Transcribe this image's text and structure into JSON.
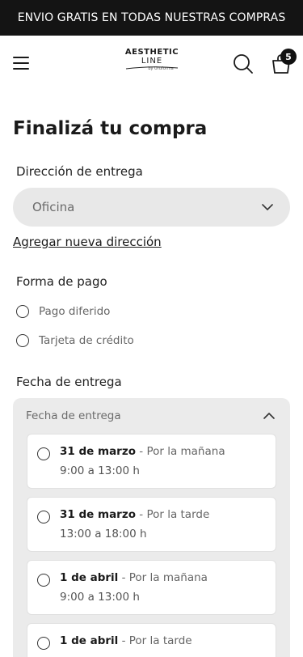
{
  "promo": {
    "text": "ENVIO GRATIS EN TODAS NUESTRAS COMPRAS"
  },
  "header": {
    "logo_line1": "AESTHETIC",
    "logo_line2": "LINE",
    "logo_sub": "by Uruforma",
    "cart_count": "5"
  },
  "page": {
    "title": "Finalizá tu compra"
  },
  "address": {
    "label": "Dirección de entrega",
    "selected": "Oficina",
    "add_link": "Agregar nueva dirección"
  },
  "payment": {
    "label": "Forma de pago",
    "options": [
      "Pago diferido",
      "Tarjeta de crédito"
    ]
  },
  "delivery": {
    "label": "Fecha de entrega",
    "accordion_title": "Fecha de entrega",
    "slots": [
      {
        "date": "31 de marzo",
        "period": " - Por la mañana",
        "hours": "9:00 a 13:00 h"
      },
      {
        "date": "31 de marzo",
        "period": " - Por la tarde",
        "hours": "13:00 a 18:00 h"
      },
      {
        "date": "1 de abril",
        "period": " - Por la mañana",
        "hours": "9:00 a 13:00 h"
      },
      {
        "date": "1 de abril",
        "period": " - Por la tarde",
        "hours": ""
      }
    ]
  },
  "colors": {
    "promo_bg": "#141414",
    "select_bg": "#e8e8e8",
    "accordion_bg": "#ebebeb"
  },
  "icons": [
    "menu-icon",
    "search-icon",
    "cart-icon",
    "chevron-down-icon",
    "chevron-up-icon"
  ]
}
